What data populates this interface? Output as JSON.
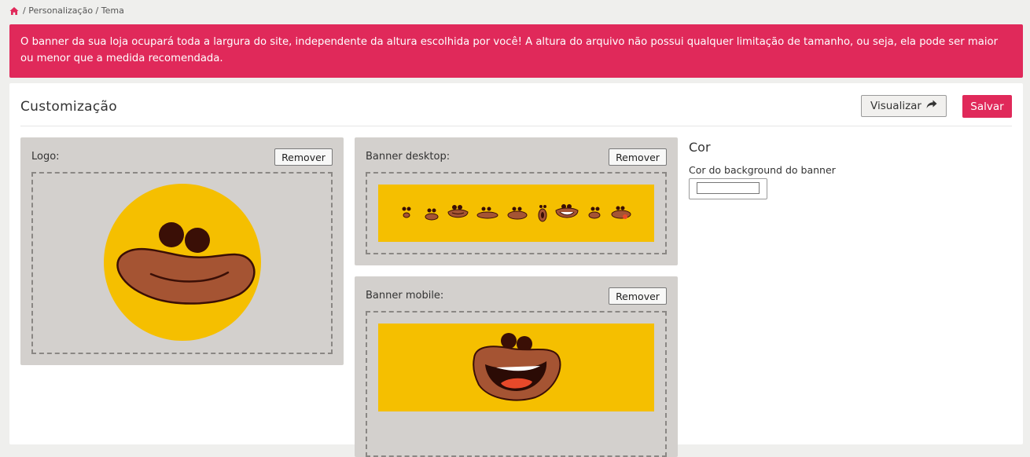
{
  "breadcrumb": {
    "home_icon": "home-icon",
    "path": "/ Personalização / Tema"
  },
  "alert": {
    "text": "O banner da sua loja ocupará toda a largura do site, independente da altura escolhida por você! A altura do arquivo não possui qualquer limitação de tamanho, ou seja, ela pode ser maior ou menor que a medida recomendada.",
    "color": "#e0295a"
  },
  "header": {
    "title": "Customização",
    "visualizar_label": "Visualizar",
    "visualizar_icon": "share-arrow-icon",
    "salvar_label": "Salvar"
  },
  "uploads": {
    "logo": {
      "label": "Logo:",
      "remove_label": "Remover"
    },
    "banner_desktop": {
      "label": "Banner desktop:",
      "remove_label": "Remover"
    },
    "banner_mobile": {
      "label": "Banner mobile:",
      "remove_label": "Remover"
    }
  },
  "cor": {
    "title": "Cor",
    "field_label": "Cor do background do banner",
    "value": "#ffffff"
  },
  "colors": {
    "accent": "#e0295a",
    "banner_yellow": "#f5bf00",
    "panel_bg": "#d3d0cd"
  }
}
